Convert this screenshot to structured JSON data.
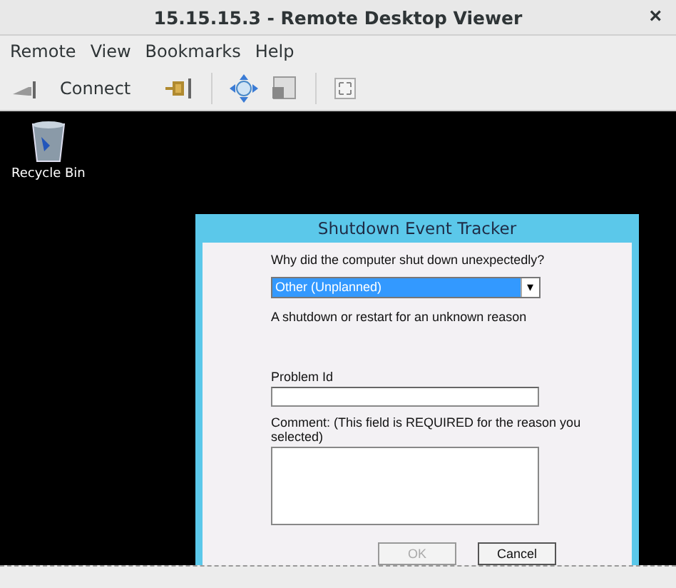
{
  "window": {
    "title": "15.15.15.3 - Remote Desktop Viewer",
    "close": "×"
  },
  "menu": [
    "Remote",
    "View",
    "Bookmarks",
    "Help"
  ],
  "toolbar": {
    "connect": "Connect"
  },
  "desktop": {
    "icon_label": "Recycle Bin"
  },
  "dialog": {
    "title": "Shutdown Event Tracker",
    "question": "Why did the computer shut down unexpectedly?",
    "reason": {
      "value": "Other (Unplanned)",
      "arrow": "▾"
    },
    "description": "A shutdown or restart for an unknown reason",
    "problem_label": "Problem Id",
    "comment_label": "Comment: (This field is REQUIRED for the reason you selected)",
    "buttons": [
      {
        "label": "OK",
        "disabled": true
      },
      {
        "label": "Cancel",
        "disabled": false
      }
    ]
  }
}
